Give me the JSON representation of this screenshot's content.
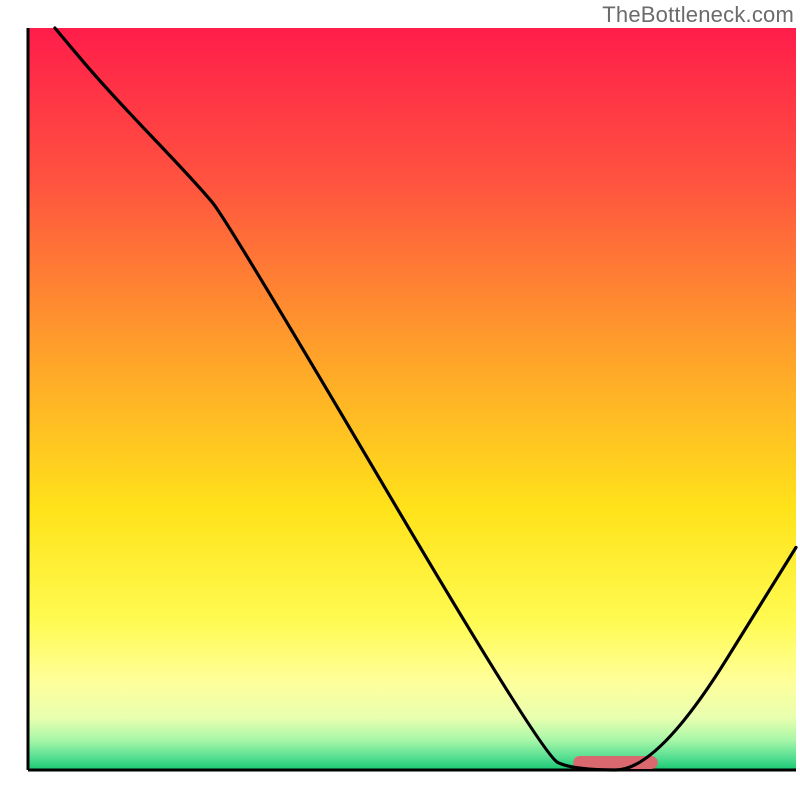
{
  "watermark": "TheBottleneck.com",
  "chart_data": {
    "type": "line",
    "title": "",
    "xlabel": "",
    "ylabel": "",
    "xlim": [
      0,
      100
    ],
    "ylim": [
      0,
      100
    ],
    "grid": false,
    "series": [
      {
        "name": "bottleneck-curve",
        "x": [
          3.5,
          10,
          22,
          26,
          67,
          71,
          82,
          100
        ],
        "values": [
          100,
          92,
          79,
          74,
          2,
          0,
          0,
          30
        ]
      }
    ],
    "marker": {
      "name": "optimal-range",
      "shape": "rounded-bar",
      "color": "#d9696e",
      "x_start": 71,
      "x_end": 82,
      "y": 0
    },
    "background": {
      "type": "vertical-gradient",
      "stops": [
        {
          "offset": 0.0,
          "color": "#ff1d4a"
        },
        {
          "offset": 0.2,
          "color": "#ff5140"
        },
        {
          "offset": 0.45,
          "color": "#ffa529"
        },
        {
          "offset": 0.65,
          "color": "#ffe31a"
        },
        {
          "offset": 0.8,
          "color": "#fffb52"
        },
        {
          "offset": 0.88,
          "color": "#ffff9a"
        },
        {
          "offset": 0.93,
          "color": "#e8ffb0"
        },
        {
          "offset": 0.96,
          "color": "#a8f7a8"
        },
        {
          "offset": 0.985,
          "color": "#4fdc8f"
        },
        {
          "offset": 1.0,
          "color": "#18c772"
        }
      ]
    },
    "axes": {
      "color": "#000000",
      "thickness_px": 3,
      "show_ticks": false
    },
    "curve_style": {
      "stroke": "#000000",
      "stroke_width_px": 3.2
    }
  }
}
